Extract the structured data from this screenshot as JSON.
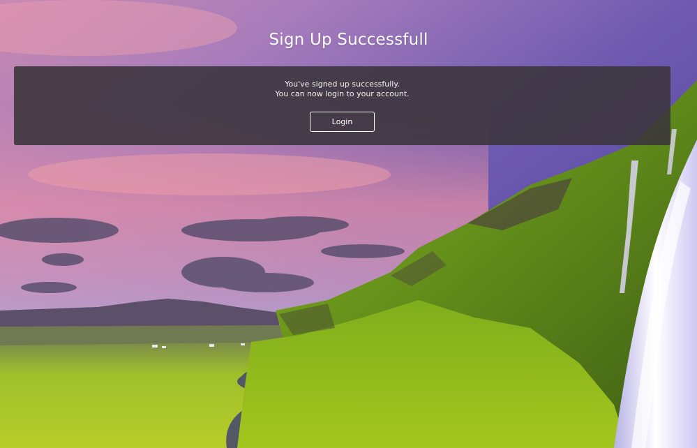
{
  "page": {
    "title": "Sign Up Successfull"
  },
  "panel": {
    "message_line_1": "You've signed up successfully.",
    "message_line_2": "You can now login to your account.",
    "login_label": "Login"
  },
  "colors": {
    "panel_bg": "#3a343a",
    "text": "#ffffff",
    "sky_top": "#5a4aa8",
    "sky_pink": "#e88aa0",
    "grass": "#8fbf22"
  },
  "background": {
    "scene": "landscape-waterfall"
  }
}
